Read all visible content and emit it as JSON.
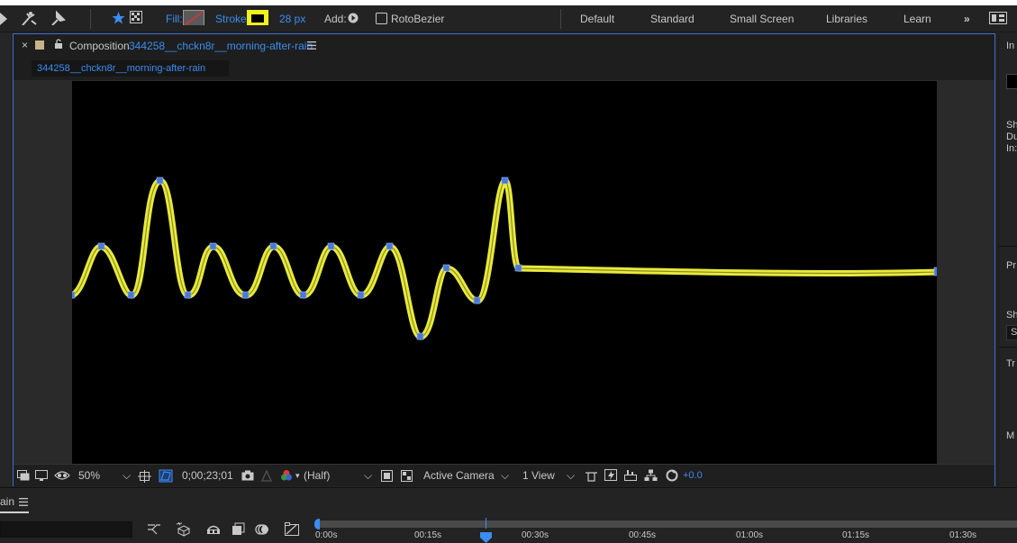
{
  "toolbar": {
    "fill_label": "Fill:",
    "stroke_label": "Stroke:",
    "stroke_width": "28 px",
    "add_label": "Add:",
    "rotobezier_label": "RotoBezier",
    "accent": "#3b8df0",
    "stroke_color": "#f2f01e"
  },
  "workspaces": [
    "Default",
    "Standard",
    "Small Screen",
    "Libraries",
    "Learn"
  ],
  "comp": {
    "panel_prefix": "Composition",
    "name": "344258__chckn8r__morning-after-rain",
    "subtab": "344258__chckn8r__morning-after-rain",
    "path_color": "#e8ea3a",
    "vertex_color": "#4a78d8"
  },
  "viewer_footer": {
    "zoom": "50%",
    "timecode": "0;00;23;01",
    "resolution": "(Half)",
    "camera": "Active Camera",
    "views": "1 View",
    "exposure": "+0.0"
  },
  "right_panel": {
    "items": [
      "In",
      "Sh",
      "Du",
      "In:",
      "Pr",
      "Sh",
      "Sh",
      "Tr",
      "M"
    ]
  },
  "timeline": {
    "tab_label": "ain",
    "ticks": [
      "0:00s",
      "00:15s",
      "00:30s",
      "00:45s",
      "01:00s",
      "01:15s",
      "01:30s"
    ]
  }
}
